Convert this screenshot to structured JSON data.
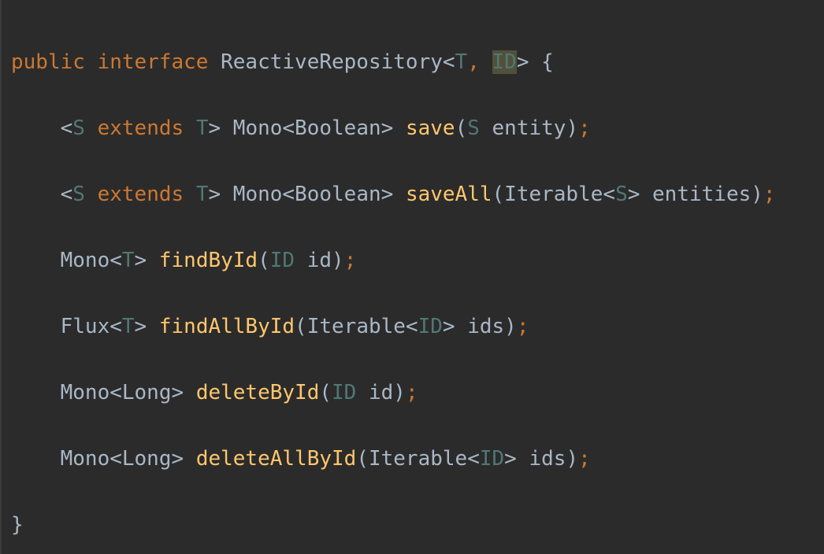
{
  "editor": {
    "colors": {
      "background": "#2b2b2b",
      "keyword": "#cc7832",
      "type_param": "#507874",
      "method": "#ffc66d",
      "plain": "#a9b7c6",
      "highlight": "#52503a"
    },
    "lines": [
      {
        "tokens": [
          {
            "text": "public",
            "cls": "kw"
          },
          {
            "text": " ",
            "cls": "pl"
          },
          {
            "text": "interface",
            "cls": "kw"
          },
          {
            "text": " ReactiveRepository<",
            "cls": "pl"
          },
          {
            "text": "T",
            "cls": "tp"
          },
          {
            "text": ", ",
            "cls": "sc"
          },
          {
            "text": "ID",
            "cls": "tp hl"
          },
          {
            "text": "> {",
            "cls": "pl"
          }
        ]
      },
      {
        "tokens": [
          {
            "text": "    <",
            "cls": "pl"
          },
          {
            "text": "S",
            "cls": "tp"
          },
          {
            "text": " ",
            "cls": "pl"
          },
          {
            "text": "extends",
            "cls": "kw"
          },
          {
            "text": " ",
            "cls": "pl"
          },
          {
            "text": "T",
            "cls": "tp"
          },
          {
            "text": "> Mono<Boolean> ",
            "cls": "pl"
          },
          {
            "text": "save",
            "cls": "fn"
          },
          {
            "text": "(",
            "cls": "pl"
          },
          {
            "text": "S",
            "cls": "tp"
          },
          {
            "text": " entity)",
            "cls": "pl"
          },
          {
            "text": ";",
            "cls": "sc"
          }
        ]
      },
      {
        "tokens": [
          {
            "text": "    <",
            "cls": "pl"
          },
          {
            "text": "S",
            "cls": "tp"
          },
          {
            "text": " ",
            "cls": "pl"
          },
          {
            "text": "extends",
            "cls": "kw"
          },
          {
            "text": " ",
            "cls": "pl"
          },
          {
            "text": "T",
            "cls": "tp"
          },
          {
            "text": "> Mono<Boolean> ",
            "cls": "pl"
          },
          {
            "text": "saveAll",
            "cls": "fn"
          },
          {
            "text": "(Iterable<",
            "cls": "pl"
          },
          {
            "text": "S",
            "cls": "tp"
          },
          {
            "text": "> entities)",
            "cls": "pl"
          },
          {
            "text": ";",
            "cls": "sc"
          }
        ]
      },
      {
        "tokens": [
          {
            "text": "    Mono<",
            "cls": "pl"
          },
          {
            "text": "T",
            "cls": "tp"
          },
          {
            "text": "> ",
            "cls": "pl"
          },
          {
            "text": "findById",
            "cls": "fn"
          },
          {
            "text": "(",
            "cls": "pl"
          },
          {
            "text": "ID",
            "cls": "tp"
          },
          {
            "text": " id)",
            "cls": "pl"
          },
          {
            "text": ";",
            "cls": "sc"
          }
        ]
      },
      {
        "tokens": [
          {
            "text": "    Flux<",
            "cls": "pl"
          },
          {
            "text": "T",
            "cls": "tp"
          },
          {
            "text": "> ",
            "cls": "pl"
          },
          {
            "text": "findAllById",
            "cls": "fn"
          },
          {
            "text": "(Iterable<",
            "cls": "pl"
          },
          {
            "text": "ID",
            "cls": "tp"
          },
          {
            "text": "> ids)",
            "cls": "pl"
          },
          {
            "text": ";",
            "cls": "sc"
          }
        ]
      },
      {
        "tokens": [
          {
            "text": "    Mono<Long> ",
            "cls": "pl"
          },
          {
            "text": "deleteById",
            "cls": "fn"
          },
          {
            "text": "(",
            "cls": "pl"
          },
          {
            "text": "ID",
            "cls": "tp"
          },
          {
            "text": " id)",
            "cls": "pl"
          },
          {
            "text": ";",
            "cls": "sc"
          }
        ]
      },
      {
        "tokens": [
          {
            "text": "    Mono<Long> ",
            "cls": "pl"
          },
          {
            "text": "deleteAllById",
            "cls": "fn"
          },
          {
            "text": "(Iterable<",
            "cls": "pl"
          },
          {
            "text": "ID",
            "cls": "tp"
          },
          {
            "text": "> ids)",
            "cls": "pl"
          },
          {
            "text": ";",
            "cls": "sc"
          }
        ]
      },
      {
        "tokens": [
          {
            "text": "}",
            "cls": "pl"
          }
        ]
      }
    ]
  }
}
